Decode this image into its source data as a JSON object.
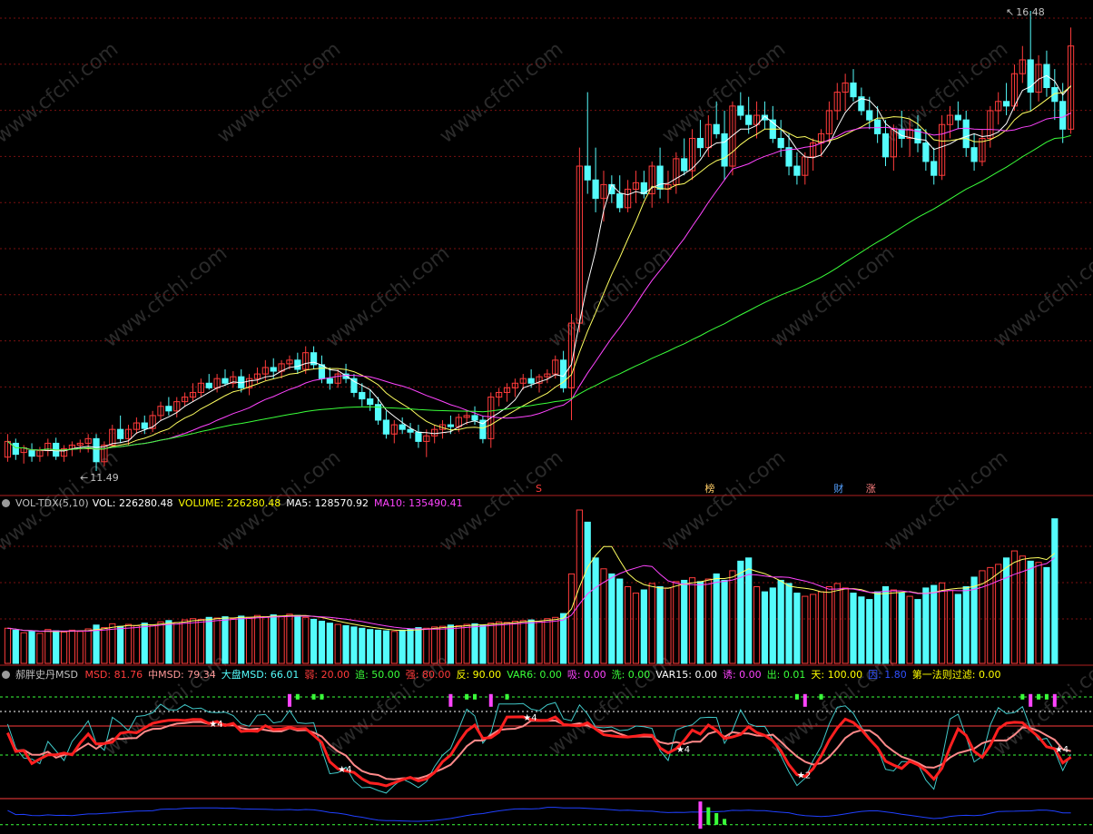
{
  "colors": {
    "up": "#ff3b3b",
    "down": "#54fcfc",
    "ma5": "#ffffff",
    "ma10": "#ffff60",
    "ma20": "#ff44ff",
    "ma60": "#3aff3a",
    "grid": "#7a1010",
    "accent": "#ffff00"
  },
  "main": {
    "title_obscured": "",
    "price_high_label": "16.48",
    "price_low_label": "11.49",
    "signal_labels": [
      {
        "text": "S",
        "color": "#ff3b3b"
      },
      {
        "text": "榜",
        "color": "#ffcc66"
      },
      {
        "text": "财",
        "color": "#54a0ff"
      },
      {
        "text": "涨",
        "color": "#ff8080"
      }
    ]
  },
  "volume_panel": {
    "name": "VOL-TDX(5,10)",
    "vol_label": "VOL: 226280.48",
    "volume_label": "VOLUME: 226280.48",
    "ma5_label": "MA5: 128570.92",
    "ma10_label": "MA10: 135490.41"
  },
  "msd_panel": {
    "name": "郝胖史丹MSD",
    "items": [
      {
        "text": "MSD: 81.76",
        "color": "#ff3b3b"
      },
      {
        "text": "中MSD: 79.34",
        "color": "#ff9999"
      },
      {
        "text": "大盘MSD: 66.01",
        "color": "#54fcfc"
      },
      {
        "text": "弱: 20.00",
        "color": "#ff3b3b"
      },
      {
        "text": "追: 50.00",
        "color": "#3aff3a"
      },
      {
        "text": "强: 80.00",
        "color": "#ff3b3b"
      },
      {
        "text": "反: 90.00",
        "color": "#ffff00"
      },
      {
        "text": "VAR6: 0.00",
        "color": "#3aff3a"
      },
      {
        "text": "吸: 0.00",
        "color": "#ff44ff"
      },
      {
        "text": "洗: 0.00",
        "color": "#3aff3a"
      },
      {
        "text": "VAR15: 0.00",
        "color": "#ffffff"
      },
      {
        "text": "诱: 0.00",
        "color": "#ff44ff"
      },
      {
        "text": "出: 0.01",
        "color": "#3aff3a"
      },
      {
        "text": "天: 100.00",
        "color": "#ffff00"
      },
      {
        "text": "因: 1.80",
        "color": "#3050ff"
      },
      {
        "text": "第一法则过滤: 0.00",
        "color": "#ffff00"
      }
    ],
    "star_labels": [
      "★4",
      "★2",
      "★4",
      "★4",
      "★4",
      "★4"
    ]
  },
  "watermark": "www.cfchi.com",
  "chart_data": {
    "type": "candlestick",
    "y_range": [
      11.49,
      16.48
    ],
    "bars": [
      [
        11.65,
        11.9,
        11.6,
        11.82
      ],
      [
        11.8,
        11.85,
        11.62,
        11.68
      ],
      [
        11.7,
        11.78,
        11.58,
        11.75
      ],
      [
        11.72,
        11.8,
        11.6,
        11.66
      ],
      [
        11.66,
        11.76,
        11.6,
        11.72
      ],
      [
        11.72,
        11.85,
        11.66,
        11.8
      ],
      [
        11.8,
        11.86,
        11.62,
        11.66
      ],
      [
        11.66,
        11.78,
        11.6,
        11.74
      ],
      [
        11.74,
        11.82,
        11.66,
        11.78
      ],
      [
        11.78,
        11.84,
        11.7,
        11.8
      ],
      [
        11.8,
        11.9,
        11.7,
        11.85
      ],
      [
        11.85,
        11.9,
        11.5,
        11.6
      ],
      [
        11.6,
        11.82,
        11.55,
        11.78
      ],
      [
        11.78,
        12.0,
        11.75,
        11.95
      ],
      [
        11.95,
        12.1,
        11.8,
        11.85
      ],
      [
        11.85,
        12.0,
        11.78,
        11.95
      ],
      [
        11.95,
        12.08,
        11.9,
        12.02
      ],
      [
        12.02,
        12.1,
        11.9,
        11.96
      ],
      [
        11.96,
        12.15,
        11.92,
        12.1
      ],
      [
        12.1,
        12.25,
        12.05,
        12.2
      ],
      [
        12.2,
        12.3,
        12.1,
        12.15
      ],
      [
        12.15,
        12.3,
        12.08,
        12.25
      ],
      [
        12.25,
        12.35,
        12.2,
        12.3
      ],
      [
        12.3,
        12.45,
        12.25,
        12.35
      ],
      [
        12.35,
        12.5,
        12.3,
        12.45
      ],
      [
        12.45,
        12.55,
        12.38,
        12.4
      ],
      [
        12.4,
        12.55,
        12.35,
        12.5
      ],
      [
        12.5,
        12.6,
        12.42,
        12.45
      ],
      [
        12.45,
        12.58,
        12.4,
        12.52
      ],
      [
        12.52,
        12.6,
        12.35,
        12.4
      ],
      [
        12.4,
        12.55,
        12.32,
        12.5
      ],
      [
        12.5,
        12.62,
        12.45,
        12.55
      ],
      [
        12.55,
        12.7,
        12.48,
        12.62
      ],
      [
        12.62,
        12.72,
        12.5,
        12.58
      ],
      [
        12.58,
        12.7,
        12.5,
        12.66
      ],
      [
        12.66,
        12.75,
        12.6,
        12.7
      ],
      [
        12.7,
        12.78,
        12.55,
        12.6
      ],
      [
        12.6,
        12.85,
        12.55,
        12.78
      ],
      [
        12.78,
        12.85,
        12.6,
        12.65
      ],
      [
        12.65,
        12.75,
        12.45,
        12.5
      ],
      [
        12.5,
        12.62,
        12.38,
        12.45
      ],
      [
        12.45,
        12.6,
        12.4,
        12.55
      ],
      [
        12.55,
        12.66,
        12.45,
        12.5
      ],
      [
        12.5,
        12.55,
        12.3,
        12.35
      ],
      [
        12.35,
        12.45,
        12.2,
        12.28
      ],
      [
        12.28,
        12.38,
        12.15,
        12.22
      ],
      [
        12.22,
        12.3,
        12.0,
        12.05
      ],
      [
        12.05,
        12.15,
        11.85,
        11.9
      ],
      [
        11.9,
        12.05,
        11.8,
        12.0
      ],
      [
        12.0,
        12.08,
        11.9,
        11.95
      ],
      [
        11.95,
        12.02,
        11.85,
        11.92
      ],
      [
        11.92,
        12.0,
        11.75,
        11.82
      ],
      [
        11.82,
        11.95,
        11.65,
        11.88
      ],
      [
        11.88,
        12.0,
        11.8,
        11.95
      ],
      [
        11.95,
        12.05,
        11.85,
        12.0
      ],
      [
        12.0,
        12.1,
        11.9,
        11.98
      ],
      [
        11.98,
        12.12,
        11.92,
        12.08
      ],
      [
        12.08,
        12.15,
        12.0,
        12.1
      ],
      [
        12.1,
        12.2,
        12.0,
        12.05
      ],
      [
        12.05,
        12.1,
        11.8,
        11.85
      ],
      [
        11.85,
        12.35,
        11.75,
        12.3
      ],
      [
        12.3,
        12.4,
        12.2,
        12.35
      ],
      [
        12.35,
        12.45,
        12.25,
        12.4
      ],
      [
        12.4,
        12.5,
        12.3,
        12.45
      ],
      [
        12.45,
        12.55,
        12.38,
        12.5
      ],
      [
        12.5,
        12.6,
        12.4,
        12.45
      ],
      [
        12.45,
        12.55,
        12.35,
        12.52
      ],
      [
        12.52,
        12.6,
        12.45,
        12.55
      ],
      [
        12.55,
        12.75,
        12.5,
        12.7
      ],
      [
        12.7,
        12.8,
        12.35,
        12.4
      ],
      [
        12.4,
        13.2,
        12.05,
        13.1
      ],
      [
        13.1,
        15.0,
        13.0,
        14.8
      ],
      [
        14.8,
        15.6,
        14.5,
        14.65
      ],
      [
        14.65,
        15.0,
        14.3,
        14.45
      ],
      [
        14.45,
        14.75,
        14.2,
        14.6
      ],
      [
        14.6,
        14.7,
        14.4,
        14.5
      ],
      [
        14.5,
        14.7,
        14.3,
        14.35
      ],
      [
        14.35,
        14.65,
        14.3,
        14.55
      ],
      [
        14.55,
        14.75,
        14.4,
        14.62
      ],
      [
        14.62,
        14.75,
        14.45,
        14.5
      ],
      [
        14.5,
        14.85,
        14.35,
        14.8
      ],
      [
        14.8,
        15.0,
        14.45,
        14.55
      ],
      [
        14.55,
        14.75,
        14.4,
        14.6
      ],
      [
        14.6,
        14.95,
        14.5,
        14.88
      ],
      [
        14.88,
        15.1,
        14.7,
        14.75
      ],
      [
        14.75,
        15.2,
        14.65,
        15.1
      ],
      [
        15.1,
        15.3,
        14.9,
        15.0
      ],
      [
        15.0,
        15.35,
        14.9,
        15.25
      ],
      [
        15.25,
        15.5,
        15.1,
        15.15
      ],
      [
        15.15,
        15.4,
        14.65,
        14.8
      ],
      [
        14.8,
        15.5,
        14.7,
        15.45
      ],
      [
        15.45,
        15.6,
        15.3,
        15.35
      ],
      [
        15.35,
        15.55,
        15.15,
        15.25
      ],
      [
        15.25,
        15.5,
        15.1,
        15.35
      ],
      [
        15.35,
        15.5,
        15.2,
        15.3
      ],
      [
        15.3,
        15.45,
        15.05,
        15.1
      ],
      [
        15.1,
        15.3,
        14.9,
        15.0
      ],
      [
        15.0,
        15.15,
        14.7,
        14.8
      ],
      [
        14.8,
        14.95,
        14.6,
        14.7
      ],
      [
        14.7,
        14.95,
        14.6,
        14.9
      ],
      [
        14.9,
        15.1,
        14.75,
        15.05
      ],
      [
        15.05,
        15.2,
        14.9,
        15.15
      ],
      [
        15.15,
        15.5,
        15.05,
        15.4
      ],
      [
        15.4,
        15.7,
        15.3,
        15.6
      ],
      [
        15.6,
        15.8,
        15.4,
        15.7
      ],
      [
        15.7,
        15.85,
        15.5,
        15.55
      ],
      [
        15.55,
        15.65,
        15.35,
        15.4
      ],
      [
        15.4,
        15.55,
        15.2,
        15.3
      ],
      [
        15.3,
        15.45,
        15.05,
        15.15
      ],
      [
        15.15,
        15.3,
        14.8,
        14.9
      ],
      [
        14.9,
        15.25,
        14.75,
        15.2
      ],
      [
        15.2,
        15.4,
        15.0,
        15.1
      ],
      [
        15.1,
        15.3,
        14.9,
        15.2
      ],
      [
        15.2,
        15.35,
        14.95,
        15.05
      ],
      [
        15.05,
        15.2,
        14.75,
        14.85
      ],
      [
        14.85,
        15.0,
        14.6,
        14.7
      ],
      [
        14.7,
        15.35,
        14.65,
        15.25
      ],
      [
        15.25,
        15.45,
        15.1,
        15.35
      ],
      [
        15.35,
        15.5,
        15.2,
        15.3
      ],
      [
        15.3,
        15.4,
        14.9,
        15.0
      ],
      [
        15.0,
        15.15,
        14.75,
        14.85
      ],
      [
        14.85,
        15.2,
        14.8,
        15.1
      ],
      [
        15.1,
        15.45,
        15.0,
        15.4
      ],
      [
        15.4,
        15.6,
        15.25,
        15.5
      ],
      [
        15.5,
        15.7,
        15.35,
        15.45
      ],
      [
        15.45,
        15.9,
        15.4,
        15.8
      ],
      [
        15.8,
        16.1,
        15.7,
        15.95
      ],
      [
        15.95,
        16.48,
        15.4,
        15.6
      ],
      [
        15.6,
        16.0,
        15.5,
        15.9
      ],
      [
        15.9,
        16.05,
        15.55,
        15.65
      ],
      [
        15.65,
        15.85,
        15.3,
        15.5
      ],
      [
        15.5,
        15.7,
        15.05,
        15.2
      ],
      [
        15.2,
        16.3,
        15.15,
        16.1
      ]
    ],
    "volume": [
      55000,
      52000,
      48000,
      50000,
      47000,
      53000,
      51000,
      49000,
      52000,
      50000,
      54000,
      60000,
      56000,
      62000,
      58000,
      61000,
      59000,
      63000,
      60000,
      65000,
      67000,
      64000,
      68000,
      70000,
      69000,
      72000,
      71000,
      73000,
      70000,
      74000,
      72000,
      75000,
      73000,
      76000,
      74000,
      77000,
      75000,
      72000,
      69000,
      66000,
      63000,
      61000,
      59000,
      57000,
      55000,
      53000,
      52000,
      51000,
      50000,
      52000,
      54000,
      56000,
      55000,
      57000,
      58000,
      60000,
      59000,
      61000,
      62000,
      60000,
      63000,
      65000,
      64000,
      66000,
      67000,
      68000,
      66000,
      70000,
      72000,
      78000,
      140000,
      240000,
      221000,
      165000,
      148000,
      140000,
      132000,
      120000,
      110000,
      115000,
      125000,
      120000,
      118000,
      128000,
      130000,
      134000,
      128000,
      132000,
      140000,
      130000,
      145000,
      160000,
      165000,
      120000,
      112000,
      118000,
      130000,
      125000,
      110000,
      105000,
      108000,
      112000,
      120000,
      125000,
      118000,
      110000,
      104000,
      100000,
      112000,
      120000,
      115000,
      110000,
      105000,
      100000,
      118000,
      122000,
      126000,
      114000,
      108000,
      120000,
      135000,
      145000,
      150000,
      155000,
      165000,
      176000,
      168000,
      160000,
      158000,
      150000,
      226280
    ],
    "vol_ma5_last": 128570.92,
    "vol_ma10_last": 135490.41,
    "msd": {
      "last": 81.76,
      "mid_last": 79.34,
      "market_last": 66.01,
      "levels": {
        "weak": 20,
        "chase": 50,
        "strong": 80,
        "rebound": 90
      }
    }
  }
}
